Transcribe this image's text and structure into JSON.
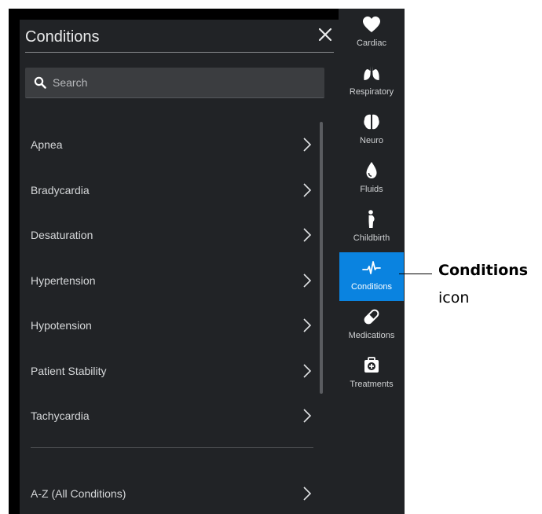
{
  "panel": {
    "title": "Conditions",
    "search_placeholder": "Search",
    "items": [
      {
        "label": "Apnea"
      },
      {
        "label": "Bradycardia"
      },
      {
        "label": "Desaturation"
      },
      {
        "label": "Hypertension"
      },
      {
        "label": "Hypotension"
      },
      {
        "label": "Patient Stability"
      },
      {
        "label": "Tachycardia"
      }
    ],
    "all_conditions_label": "A-Z (All Conditions)"
  },
  "sidebar": {
    "items": [
      {
        "label": "Cardiac",
        "icon": "heart-icon"
      },
      {
        "label": "Respiratory",
        "icon": "lungs-icon"
      },
      {
        "label": "Neuro",
        "icon": "brain-icon"
      },
      {
        "label": "Fluids",
        "icon": "droplet-icon"
      },
      {
        "label": "Childbirth",
        "icon": "pregnant-person-icon"
      },
      {
        "label": "Conditions",
        "icon": "heartbeat-pulse-icon",
        "active": true
      },
      {
        "label": "Medications",
        "icon": "pill-icon"
      },
      {
        "label": "Treatments",
        "icon": "medical-kit-icon"
      }
    ]
  },
  "callout": {
    "title": "Conditions",
    "subtitle": "icon"
  },
  "colors": {
    "panel_bg": "#212326",
    "active_accent": "#0a83e0",
    "text": "#d6d8da"
  }
}
